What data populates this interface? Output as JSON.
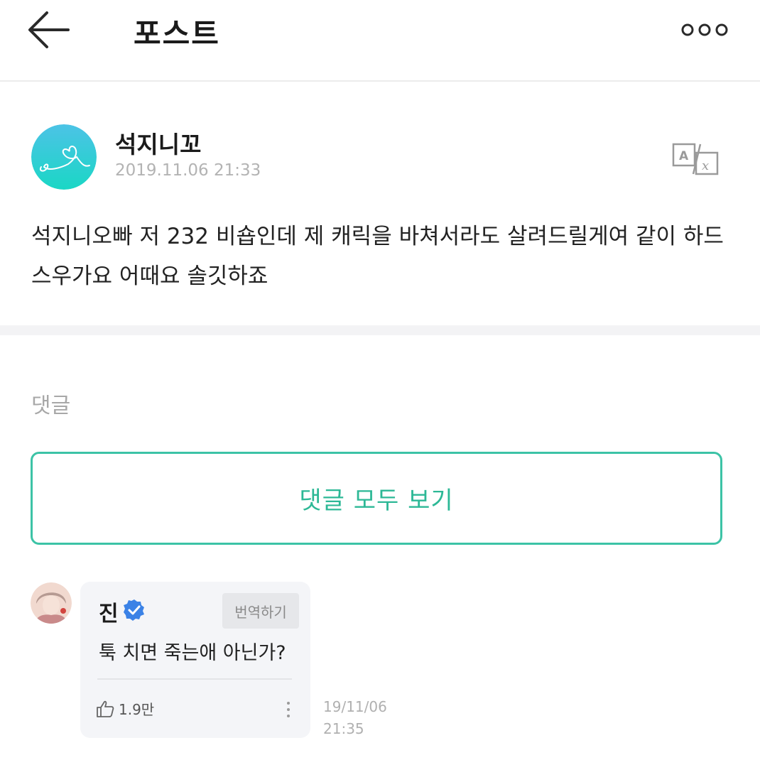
{
  "header": {
    "title": "포스트",
    "back_icon": "back-arrow-icon",
    "more_icon": "more-dots-icon"
  },
  "post": {
    "author": "석지니꼬",
    "date": "2019.11.06 21:33",
    "text": "석지니오빠 저 232 비숍인데 제 캐릭을 바쳐서라도 살려드릴게여 같이 하드스우가요 어때요 솔깃하죠",
    "translate_icon": "translate-icon",
    "avatar_color": "#2fd0cf"
  },
  "comments": {
    "heading": "댓글",
    "view_all_label": "댓글 모두 보기",
    "accent_color": "#3cc3a6",
    "items": [
      {
        "author": "진",
        "verified_icon": "verified-badge-icon",
        "translate_label": "번역하기",
        "text": "툭 치면 죽는애 아닌가?",
        "likes": "1.9만",
        "date": "19/11/06",
        "time": "21:35"
      }
    ]
  }
}
